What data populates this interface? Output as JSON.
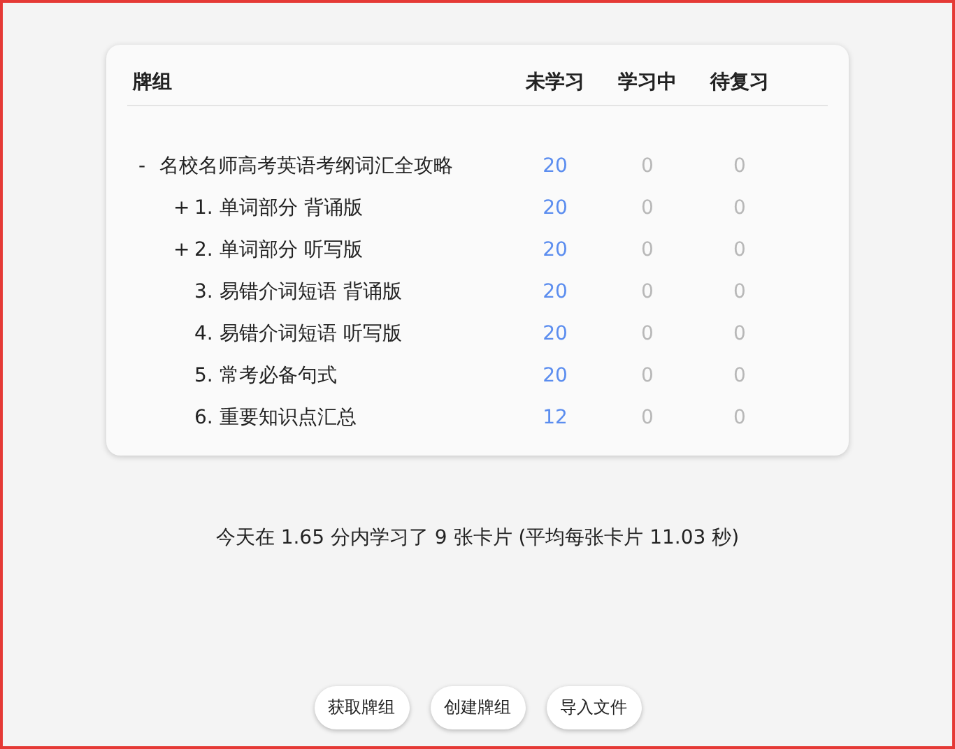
{
  "deck_table": {
    "columns": [
      "牌组",
      "未学习",
      "学习中",
      "待复习"
    ],
    "decks": [
      {
        "toggle": "-",
        "name": "名校名师高考英语考纲词汇全攻略",
        "new": "20",
        "learning": "0",
        "review": "0",
        "children": [
          {
            "toggle": "+",
            "name": "1. 单词部分 背诵版",
            "new": "20",
            "learning": "0",
            "review": "0"
          },
          {
            "toggle": "+",
            "name": "2. 单词部分 听写版",
            "new": "20",
            "learning": "0",
            "review": "0"
          },
          {
            "name": "3. 易错介词短语 背诵版",
            "new": "20",
            "learning": "0",
            "review": "0"
          },
          {
            "name": "4. 易错介词短语 听写版",
            "new": "20",
            "learning": "0",
            "review": "0"
          },
          {
            "name": "5. 常考必备句式",
            "new": "20",
            "learning": "0",
            "review": "0"
          },
          {
            "name": "6. 重要知识点汇总",
            "new": "12",
            "learning": "0",
            "review": "0"
          }
        ]
      }
    ]
  },
  "study_summary": "今天在 1.65 分内学习了 9 张卡片  (平均每张卡片 11.03 秒)",
  "buttons": [
    "获取牌组",
    "创建牌组",
    "导入文件"
  ]
}
